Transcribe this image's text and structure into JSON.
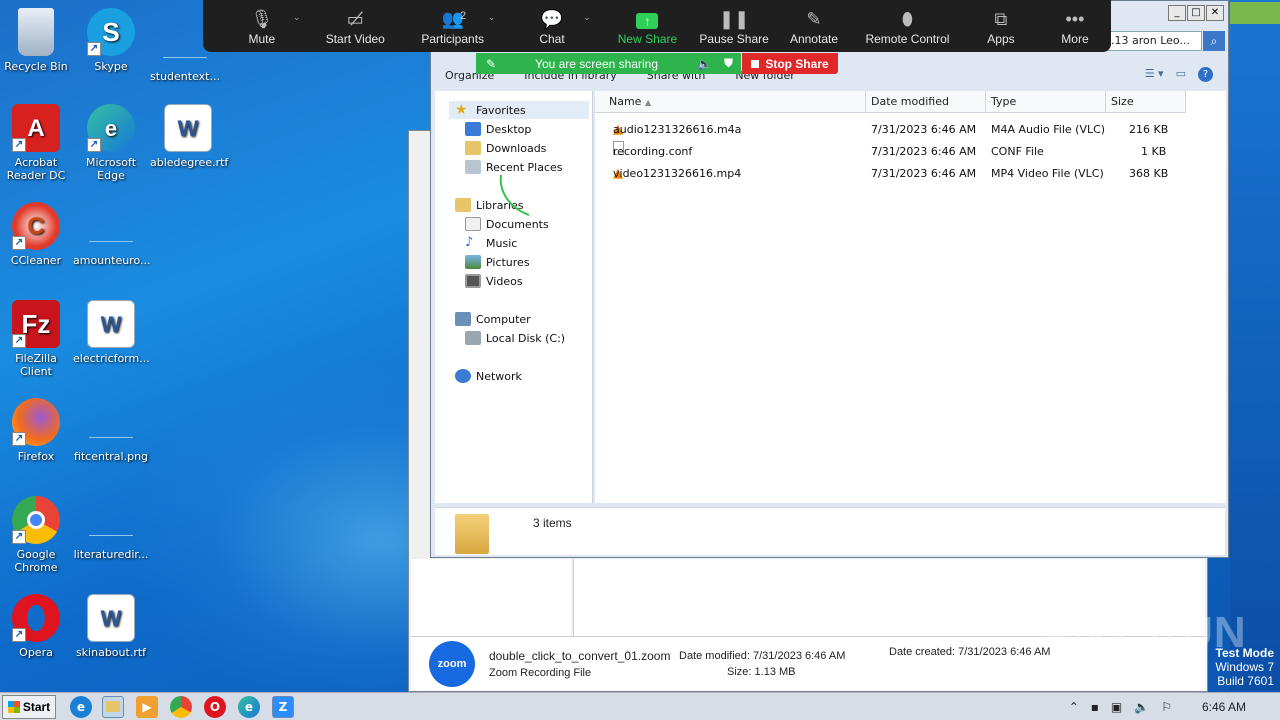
{
  "desktop": {
    "icons": [
      {
        "label": "Recycle Bin",
        "icon": "recycle-bin-icon"
      },
      {
        "label": "Skype",
        "icon": "skype-icon"
      },
      {
        "label": "studentext...",
        "icon": "blank-file-icon"
      },
      {
        "label": "Acrobat Reader DC",
        "icon": "acrobat-icon"
      },
      {
        "label": "Microsoft Edge",
        "icon": "edge-icon"
      },
      {
        "label": "abledegree.rtf",
        "icon": "word-doc-icon"
      },
      {
        "label": "CCleaner",
        "icon": "ccleaner-icon"
      },
      {
        "label": "amounteuro...",
        "icon": "blank-file-icon"
      },
      {
        "label": "FileZilla Client",
        "icon": "filezilla-icon"
      },
      {
        "label": "electricform...",
        "icon": "word-doc-icon"
      },
      {
        "label": "Firefox",
        "icon": "firefox-icon"
      },
      {
        "label": "fitcentral.png",
        "icon": "blank-file-icon"
      },
      {
        "label": "Google Chrome",
        "icon": "chrome-icon"
      },
      {
        "label": "literaturedir...",
        "icon": "blank-file-icon"
      },
      {
        "label": "Opera",
        "icon": "opera-icon"
      },
      {
        "label": "skinabout.rtf",
        "icon": "word-doc-icon"
      }
    ]
  },
  "zoom": {
    "toolbar": {
      "mute": "Mute",
      "start_video": "Start Video",
      "participants": "Participants",
      "participants_count": "2",
      "chat": "Chat",
      "new_share": "New Share",
      "pause_share": "Pause Share",
      "annotate": "Annotate",
      "remote_control": "Remote Control",
      "apps": "Apps",
      "more": "More"
    },
    "banner": "You are screen sharing",
    "stop_share": "Stop Share"
  },
  "explorer": {
    "search_text": ".13 aron Leo...",
    "cmdbar": {
      "organize": "Organize",
      "include": "Include in library",
      "share": "Share with",
      "new_folder": "New folder"
    },
    "nav": {
      "favorites": "Favorites",
      "desktop": "Desktop",
      "downloads": "Downloads",
      "recent": "Recent Places",
      "libraries": "Libraries",
      "documents": "Documents",
      "music": "Music",
      "pictures": "Pictures",
      "videos": "Videos",
      "computer": "Computer",
      "local_disk": "Local Disk (C:)",
      "network": "Network"
    },
    "columns": {
      "name": "Name",
      "date": "Date modified",
      "type": "Type",
      "size": "Size"
    },
    "files": [
      {
        "name": "audio1231326616.m4a",
        "date": "7/31/2023 6:46 AM",
        "type": "M4A Audio File (VLC)",
        "size": "216 KB",
        "icon": "vlc-icon"
      },
      {
        "name": "recording.conf",
        "date": "7/31/2023 6:46 AM",
        "type": "CONF File",
        "size": "1 KB",
        "icon": "file-icon"
      },
      {
        "name": "video1231326616.mp4",
        "date": "7/31/2023 6:46 AM",
        "type": "MP4 Video File (VLC)",
        "size": "368 KB",
        "icon": "vlc-icon"
      }
    ],
    "status": "3 items"
  },
  "details_pane": {
    "logo": "zoom",
    "filename": "double_click_to_convert_01.zoom",
    "filetype": "Zoom Recording File",
    "date_modified_label": "Date modified:",
    "date_modified": "7/31/2023 6:46 AM",
    "size_label": "Size:",
    "size": "1.13 MB",
    "date_created_label": "Date created:",
    "date_created": "7/31/2023 6:46 AM"
  },
  "watermark": "ANY RUN",
  "test_mode": {
    "line1": "Test Mode",
    "line2": "Windows 7",
    "line3": "Build 7601"
  },
  "taskbar": {
    "start": "Start",
    "clock": "6:46 AM"
  }
}
